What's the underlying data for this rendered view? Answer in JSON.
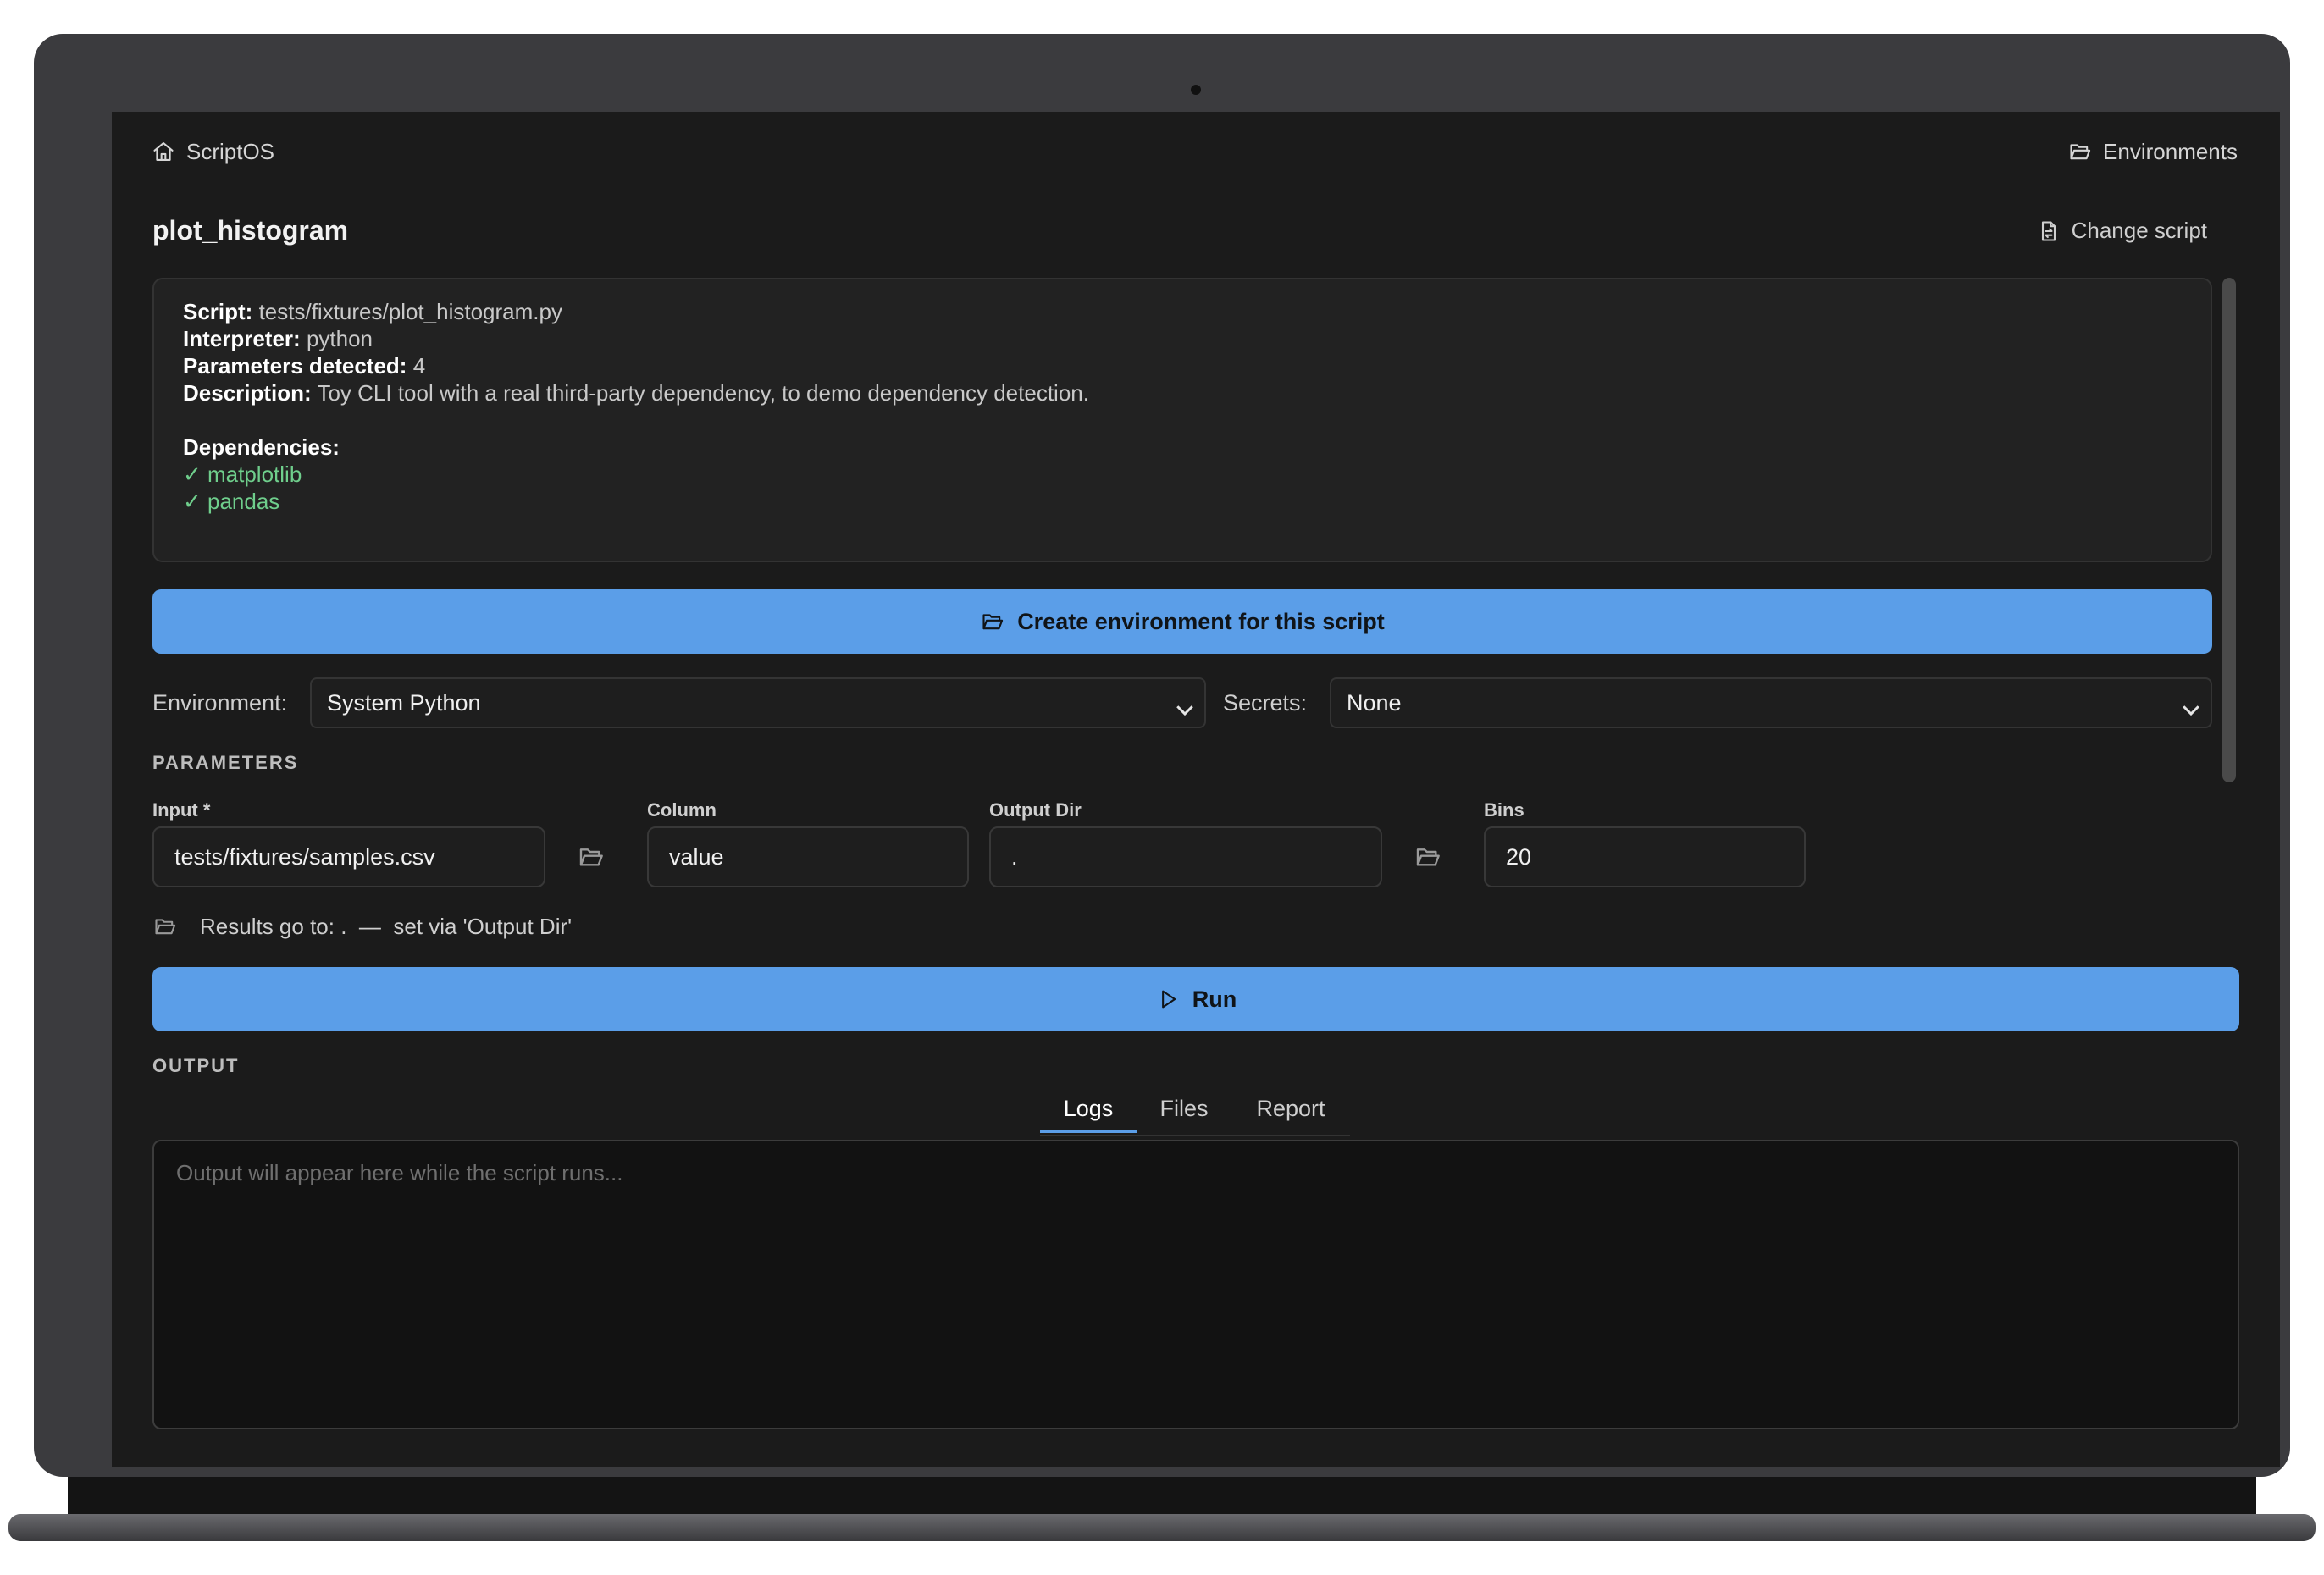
{
  "app": {
    "name": "ScriptOS",
    "environments_link": "Environments"
  },
  "page": {
    "title": "plot_histogram",
    "change_script": "Change script"
  },
  "script_info": {
    "script_label": "Script:",
    "script_value": "tests/fixtures/plot_histogram.py",
    "interpreter_label": "Interpreter:",
    "interpreter_value": "python",
    "params_label": "Parameters detected:",
    "params_value": "4",
    "description_label": "Description:",
    "description_value": "Toy CLI tool with a real third-party dependency, to demo dependency detection.",
    "dependencies_label": "Dependencies:",
    "dependencies": [
      "✓ matplotlib",
      "✓ pandas"
    ],
    "dependency_color": "#6fce8c"
  },
  "create_env_button": "Create environment for this script",
  "environment": {
    "label": "Environment:",
    "value": "System Python"
  },
  "secrets": {
    "label": "Secrets:",
    "value": "None"
  },
  "parameters": {
    "section_title": "PARAMETERS",
    "fields": {
      "input": {
        "label": "Input *",
        "value": "tests/fixtures/samples.csv"
      },
      "column": {
        "label": "Column",
        "value": "value"
      },
      "output_dir": {
        "label": "Output Dir",
        "value": "."
      },
      "bins": {
        "label": "Bins",
        "value": "20"
      }
    },
    "results_hint": "Results go to: .  —  set via 'Output Dir'"
  },
  "run_button": "Run",
  "output": {
    "section_title": "OUTPUT",
    "tabs": [
      "Logs",
      "Files",
      "Report"
    ],
    "active_tab": "Logs",
    "placeholder": "Output will appear here while the script runs..."
  },
  "colors": {
    "accent": "#5b9ee8",
    "background": "#1b1b1b",
    "panel": "#222222"
  }
}
